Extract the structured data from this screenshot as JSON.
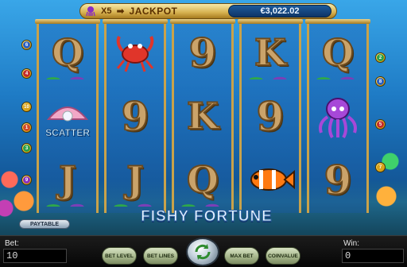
{
  "game": {
    "title": "FISHY FORTUNE",
    "jackpot": {
      "multiplier": "X5",
      "arrow": "➡",
      "label": "JACKPOT",
      "amount": "€3,022.02",
      "octopus_icon": "octopus-icon"
    },
    "line_markers_left": [
      "6",
      "4",
      "10",
      "1",
      "3",
      "9"
    ],
    "line_markers_right": [
      "2",
      "8",
      "5",
      "7"
    ],
    "reels": [
      [
        "Q",
        "scatter-pearl",
        "J"
      ],
      [
        "crab",
        "9",
        "J"
      ],
      [
        "9",
        "K",
        "Q"
      ],
      [
        "K",
        "9",
        "clownfish"
      ],
      [
        "Q",
        "octopus",
        "9"
      ]
    ],
    "scatter_label": "SCATTER",
    "paytable": "PAYTABLE",
    "bottom": {
      "bet_label": "Bet:",
      "bet_value": "10",
      "win_label": "Win:",
      "win_value": "0",
      "bet_level": "BET LEVEL",
      "bet_lines": "BET LINES",
      "max_bet": "MAX BET",
      "coin_value_1": "COIN",
      "coin_value_2": "VALUE",
      "spin_icon": "spin-arrows-icon"
    }
  }
}
